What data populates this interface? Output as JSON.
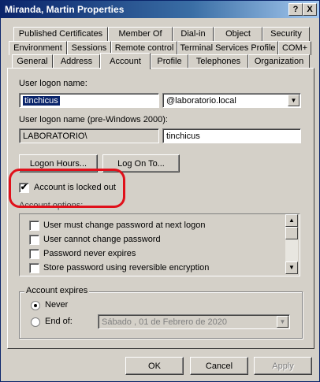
{
  "window": {
    "title": "Miranda, Martin Properties",
    "help_btn": "?",
    "close_btn": "X"
  },
  "tabs_row1": [
    "Published Certificates",
    "Member Of",
    "Dial-in",
    "Object",
    "Security"
  ],
  "tabs_row2": [
    "Environment",
    "Sessions",
    "Remote control",
    "Terminal Services Profile",
    "COM+"
  ],
  "tabs_row3": [
    "General",
    "Address",
    "Account",
    "Profile",
    "Telephones",
    "Organization"
  ],
  "active_tab": "Account",
  "account": {
    "logon_label": "User logon name:",
    "logon_value": "tinchicus",
    "domain_value": "@laboratorio.local",
    "pre2000_label": "User logon name (pre-Windows 2000):",
    "pre2000_domain": "LABORATORIO\\",
    "pre2000_value": "tinchicus",
    "logon_hours_btn": "Logon Hours...",
    "logon_to_btn": "Log On To...",
    "locked_label": "Account is locked out",
    "locked_checked": true,
    "options_title": "Account options:",
    "options": [
      {
        "label": "User must change password at next logon",
        "checked": false
      },
      {
        "label": "User cannot change password",
        "checked": false
      },
      {
        "label": "Password never expires",
        "checked": false
      },
      {
        "label": "Store password using reversible encryption",
        "checked": false
      }
    ],
    "expires_title": "Account expires",
    "never_label": "Never",
    "endof_label": "End of:",
    "endof_date": "Sábado , 01 de   Febrero   de 2020",
    "selected_expiry": "Never"
  },
  "footer": {
    "ok": "OK",
    "cancel": "Cancel",
    "apply": "Apply"
  },
  "colors": {
    "highlight": "#e0101a",
    "title_bar": "#0a246a",
    "face": "#d4d0c8"
  }
}
